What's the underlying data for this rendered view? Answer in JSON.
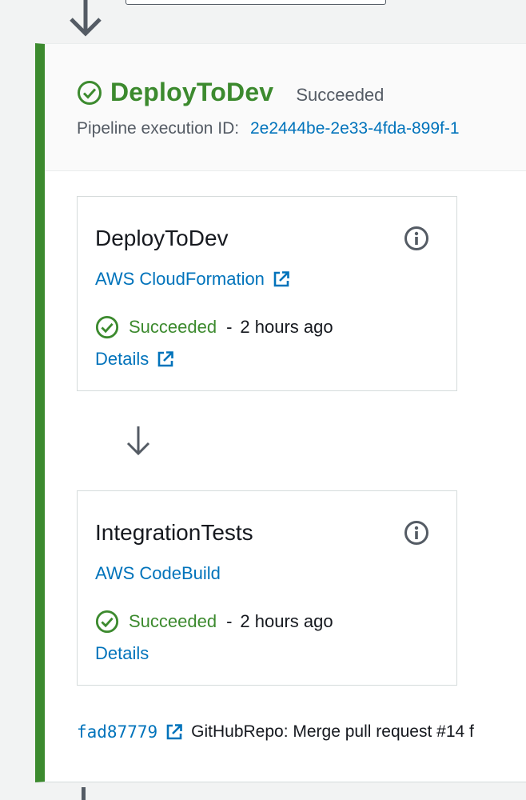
{
  "stage": {
    "title": "DeployToDev",
    "status": "Succeeded",
    "execution_label": "Pipeline execution ID:",
    "execution_id": "2e2444be-2e33-4fda-899f-1",
    "accent_color": "#3c8a2e"
  },
  "actions": [
    {
      "name": "DeployToDev",
      "provider": "AWS CloudFormation",
      "provider_external_icon": "external-link-icon",
      "status": "Succeeded",
      "separator": "-",
      "time": "2 hours ago",
      "details": "Details",
      "details_external_icon": "external-link-icon"
    },
    {
      "name": "IntegrationTests",
      "provider": "AWS CodeBuild",
      "status": "Succeeded",
      "separator": "-",
      "time": "2 hours ago",
      "details": "Details"
    }
  ],
  "commit": {
    "id": "fad87779",
    "message": "GitHubRepo: Merge pull request #14 f"
  },
  "colors": {
    "success": "#3c8a2e",
    "link": "#0073bb",
    "text": "#16191f",
    "muted": "#545b64"
  }
}
